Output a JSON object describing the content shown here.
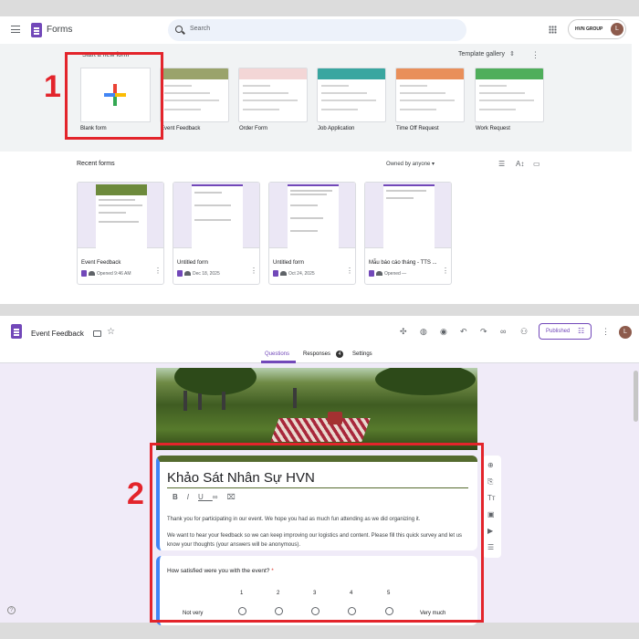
{
  "annotations": {
    "step1": "1",
    "step2": "2"
  },
  "home": {
    "app_title": "Forms",
    "search_placeholder": "Search",
    "org_name": "HVN GROUP",
    "avatar": "L",
    "start_label": "Start a new form",
    "template_gallery": "Template gallery",
    "templates": [
      {
        "label": "Blank form"
      },
      {
        "label": "Event Feedback",
        "accent": "#9aa36b"
      },
      {
        "label": "Order Form",
        "accent": "#e06565"
      },
      {
        "label": "Job Application",
        "accent": "#39a6a0"
      },
      {
        "label": "Time Off Request",
        "accent": "#e98f5a"
      },
      {
        "label": "Work Request",
        "accent": "#4fae5b"
      }
    ],
    "recent_label": "Recent forms",
    "owned_by": "Owned by anyone",
    "recent_forms": [
      {
        "title": "Event Feedback",
        "meta": "Opened 9:46 AM"
      },
      {
        "title": "Untitled form",
        "meta": "Dec 18, 2025"
      },
      {
        "title": "Untitled form",
        "meta": "Oct 24, 2025"
      },
      {
        "title": "Mẫu báo cáo tháng - TTS ...",
        "meta": "Opened —"
      }
    ]
  },
  "editor": {
    "doc_title": "Event Feedback",
    "publish_label": "Published",
    "avatar": "L",
    "tabs": {
      "questions": "Questions",
      "responses": "Responses",
      "responses_count": "4",
      "settings": "Settings"
    },
    "form_title": "Khảo Sát Nhân Sự HVN",
    "description_1": "Thank you for participating in our event. We hope you had as much fun attending as we did organizing it.",
    "description_2": "We want to hear your feedback so we can keep improving our logistics and content. Please fill this quick survey and let us know your thoughts (your answers will be anonymous).",
    "question": {
      "text": "How satisfied were you with the event?",
      "required_mark": "*",
      "scale": [
        "1",
        "2",
        "3",
        "4",
        "5"
      ],
      "low_label": "Not very",
      "high_label": "Very much"
    },
    "colors": {
      "theme": "#556b2f",
      "accent": "#7248b9",
      "highlight": "#e3242b"
    }
  }
}
